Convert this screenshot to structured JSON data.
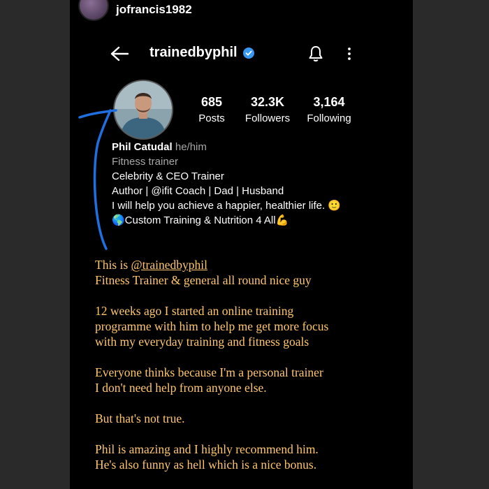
{
  "story_user": {
    "username": "jofrancis1982"
  },
  "header": {
    "username": "trainedbyphil"
  },
  "stats": {
    "posts": {
      "value": "685",
      "label": "Posts"
    },
    "followers": {
      "value": "32.3K",
      "label": "Followers"
    },
    "following": {
      "value": "3,164",
      "label": "Following"
    }
  },
  "bio": {
    "name": "Phil Catudal",
    "pronouns": "he/him",
    "category": "Fitness trainer",
    "lines": [
      "Celebrity & CEO Trainer",
      "Author | @ifit Coach | Dad | Husband",
      "I will help you achieve a happier, healthier life. 🙂",
      "🌎Custom Training & Nutrition 4 All💪"
    ]
  },
  "caption": {
    "intro": "This is ",
    "handle": "@trainedbyphil",
    "line2": "Fitness Trainer & general all round nice guy",
    "para2": [
      "12 weeks ago I started an online training",
      "programme with him to help me get more focus",
      "with my everyday training and fitness goals"
    ],
    "para3": [
      "Everyone thinks because I'm a personal trainer",
      "I don't need help from anyone else."
    ],
    "para4": "But that's not true.",
    "para5": [
      "Phil is amazing and I highly recommend him.",
      "He's also funny as hell which is a nice bonus."
    ]
  },
  "colors": {
    "caption_text": "#ffc66d",
    "annotation_arrow": "#1f6fe0",
    "verified_badge": "#3897f0"
  },
  "icons": [
    "back-arrow-icon",
    "verified-badge-icon",
    "bell-icon",
    "more-options-icon"
  ]
}
